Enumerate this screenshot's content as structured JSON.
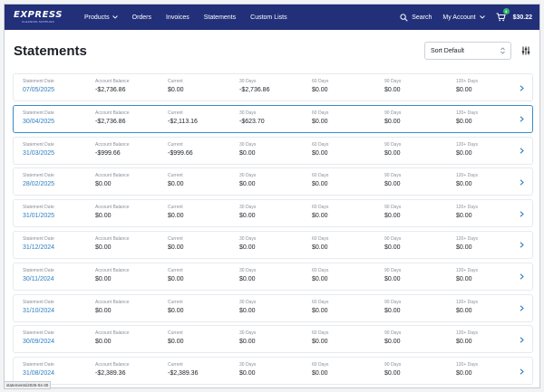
{
  "nav": {
    "logo_main": "EXPRESS",
    "logo_sub": "CLEANING SUPPLIES",
    "links": [
      {
        "label": "Products",
        "has_dropdown": true
      },
      {
        "label": "Orders",
        "has_dropdown": false
      },
      {
        "label": "Invoices",
        "has_dropdown": false
      },
      {
        "label": "Statements",
        "has_dropdown": false
      },
      {
        "label": "Custom Lists",
        "has_dropdown": false
      }
    ],
    "search_label": "Search",
    "account_label": "My Account",
    "cart_count": "3",
    "cart_total": "$30.22",
    "colors": {
      "bar": "#22307a",
      "accent": "#2c7dc0",
      "badge": "#2fb96b"
    }
  },
  "page": {
    "title": "Statements",
    "sort_value": "Sort Default"
  },
  "columns": [
    "Statement Date",
    "Account Balance",
    "Current",
    "30 Days",
    "60 Days",
    "90 Days",
    "120+ Days"
  ],
  "statements": [
    {
      "date": "07/05/2025",
      "balance": "-$2,736.86",
      "current": "$0.00",
      "d30": "-$2,736.86",
      "d60": "$0.00",
      "d90": "$0.00",
      "d120": "$0.00"
    },
    {
      "date": "30/04/2025",
      "balance": "-$2,736.86",
      "current": "-$2,113.16",
      "d30": "-$623.70",
      "d60": "$0.00",
      "d90": "$0.00",
      "d120": "$0.00"
    },
    {
      "date": "31/03/2025",
      "balance": "-$999.66",
      "current": "-$999.66",
      "d30": "$0.00",
      "d60": "$0.00",
      "d90": "$0.00",
      "d120": "$0.00"
    },
    {
      "date": "28/02/2025",
      "balance": "$0.00",
      "current": "$0.00",
      "d30": "$0.00",
      "d60": "$0.00",
      "d90": "$0.00",
      "d120": "$0.00"
    },
    {
      "date": "31/01/2025",
      "balance": "$0.00",
      "current": "$0.00",
      "d30": "$0.00",
      "d60": "$0.00",
      "d90": "$0.00",
      "d120": "$0.00"
    },
    {
      "date": "31/12/2024",
      "balance": "$0.00",
      "current": "$0.00",
      "d30": "$0.00",
      "d60": "$0.00",
      "d90": "$0.00",
      "d120": "$0.00"
    },
    {
      "date": "30/11/2024",
      "balance": "$0.00",
      "current": "$0.00",
      "d30": "$0.00",
      "d60": "$0.00",
      "d90": "$0.00",
      "d120": "$0.00"
    },
    {
      "date": "31/10/2024",
      "balance": "$0.00",
      "current": "$0.00",
      "d30": "$0.00",
      "d60": "$0.00",
      "d90": "$0.00",
      "d120": "$0.00"
    },
    {
      "date": "30/09/2024",
      "balance": "$0.00",
      "current": "$0.00",
      "d30": "$0.00",
      "d60": "$0.00",
      "d90": "$0.00",
      "d120": "$0.00"
    },
    {
      "date": "31/08/2024",
      "balance": "-$2,389.36",
      "current": "-$2,389.36",
      "d30": "$0.00",
      "d60": "$0.00",
      "d90": "$0.00",
      "d120": "$0.00"
    }
  ],
  "status_url": "statements/2025-04-30"
}
